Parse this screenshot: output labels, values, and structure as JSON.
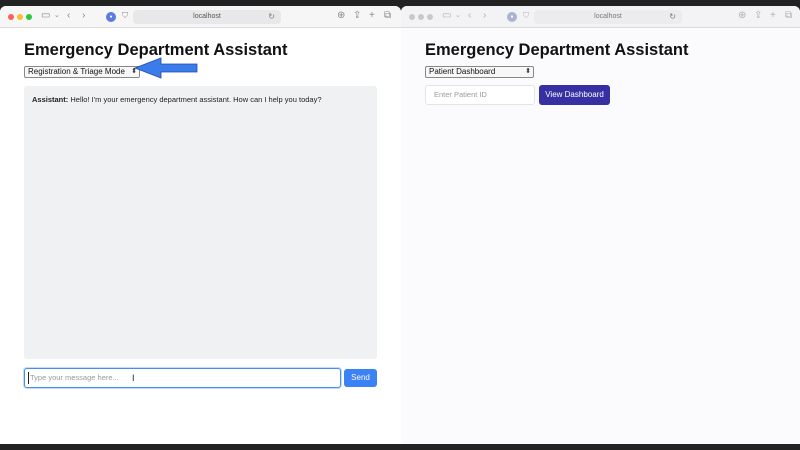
{
  "left_window": {
    "url": "localhost",
    "page_title": "Emergency Department Assistant",
    "mode_select": {
      "selected": "Registration & Triage Mode"
    },
    "chat": {
      "speaker": "Assistant:",
      "message": "Hello! I'm your emergency department assistant. How can I help you today?"
    },
    "message_input": {
      "placeholder": "Type your message here..."
    },
    "send_label": "Send"
  },
  "right_window": {
    "url": "localhost",
    "page_title": "Emergency Department Assistant",
    "view_select": {
      "selected": "Patient Dashboard"
    },
    "patient_input": {
      "placeholder": "Enter Patient ID"
    },
    "view_button_label": "View Dashboard"
  },
  "colors": {
    "send_button": "#3b82f6",
    "view_button": "#3730a3",
    "annotation_arrow": "#3b7bea",
    "chat_background": "#f0f1f3"
  }
}
